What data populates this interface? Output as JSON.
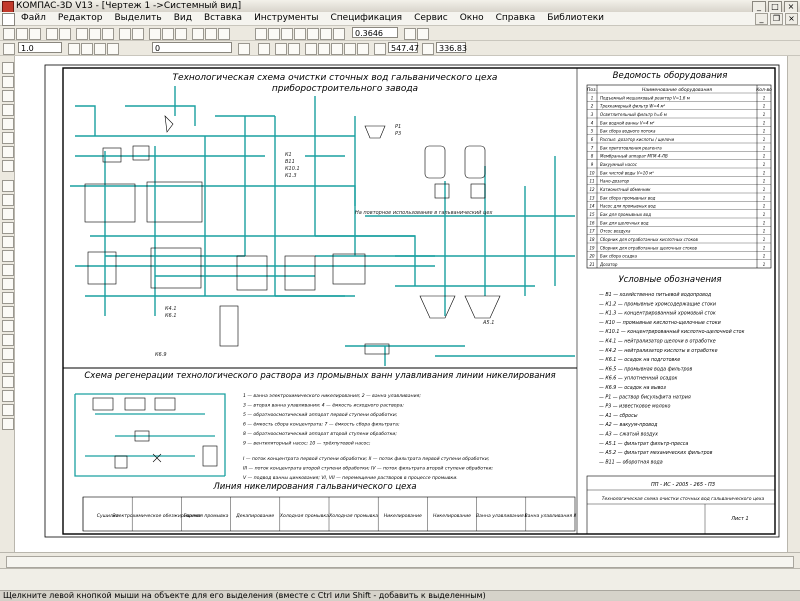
{
  "window": {
    "title": "КОМПАС-3D V13 - [Чертеж 1 ->Системный вид]"
  },
  "menu": [
    "Файл",
    "Редактор",
    "Выделить",
    "Вид",
    "Вставка",
    "Инструменты",
    "Спецификация",
    "Сервис",
    "Окно",
    "Справка",
    "Библиотеки"
  ],
  "toolbar": {
    "scale_value": "1.0",
    "layer_value": "0",
    "zoom_value": "0.3646",
    "coord_x": "547.47",
    "coord_y": "336.83"
  },
  "drawing": {
    "main_title": "Технологическая схема очистки сточных вод гальванического цеха",
    "main_subtitle": "приборостроительного завода",
    "equipment_title": "Ведомость оборудования",
    "equipment_header": [
      "Поз.",
      "Наименование оборудования",
      "Кол-во"
    ],
    "equipment_rows": [
      [
        "1",
        "Подъемный мешалковый реактор V=1,6 м",
        "1"
      ],
      [
        "2",
        "Трехкамерный фильтр W=4 м²",
        "1"
      ],
      [
        "3",
        "Осветлительный фильтр h=6 м",
        "1"
      ],
      [
        "4",
        "Бак водной ванны V=4 м³",
        "1"
      ],
      [
        "5",
        "Бак сбора водного потока",
        "1"
      ],
      [
        "6",
        "Распыл. дозатор кислоты / щелочи",
        "1"
      ],
      [
        "7",
        "Бак приготовления реагента",
        "1"
      ],
      [
        "8",
        "Мембранный аппарат МГМ-4-ЛВ",
        "1"
      ],
      [
        "9",
        "Вакуумный насос",
        "1"
      ],
      [
        "10",
        "Бак чистой воды V=10 м³",
        "1"
      ],
      [
        "11",
        "Нано-дозатор",
        "1"
      ],
      [
        "12",
        "Катионитный обменник",
        "1"
      ],
      [
        "13",
        "Бак сбора промывных вод",
        "1"
      ],
      [
        "14",
        "Насос для промывных вод",
        "1"
      ],
      [
        "15",
        "Бак для промывных вод",
        "1"
      ],
      [
        "16",
        "Бак для щелочных вод",
        "1"
      ],
      [
        "17",
        "Отсос воздуха",
        "1"
      ],
      [
        "18",
        "Сборник для отработанных кислотных стоков",
        "1"
      ],
      [
        "19",
        "Сборник для отработанных щелочных стоков",
        "1"
      ],
      [
        "20",
        "Бак сбора осадка",
        "1"
      ],
      [
        "21",
        "Дозатор",
        "1"
      ]
    ],
    "legend_title": "Условные обозначения",
    "legend_items": [
      "— В1 — хозяйственно питьевой водопровод",
      "— К1.2 — промывные хромсодержащие стоки",
      "— К1.3 — концентрированный хромовый сток",
      "— К10 — промывные кислотно-щелочные стоки",
      "— К10.1 — концентрированный кислотно-щелочной сток",
      "— К4.1 — нейтрализатор щелочи в отработке",
      "— К4.2 — нейтрализатор кислоты в отработке",
      "— К6.1 — осадок на подготовке",
      "— К6.5 — промывная вода фильтров",
      "— К6.6 — уплотненный осадок",
      "— К6.9 — осадок на вывоз",
      "— Р1 — раствор бисульфита натрия",
      "— Р3 — известковое молоко",
      "— А1 — сбросы",
      "— А2 — вакуум-провод",
      "— А3 — сжатый воздух",
      "— А5.1 — фильтрат фильтр-пресса",
      "— А5.2 — фильтрат механических фильтров",
      "— В11 — оборотная вода"
    ],
    "regen_title": "Схема регенерации технологического раствора из промывных ванн улавливания линии никелирования",
    "regen_notes": [
      "1 — ванна электрохимического никелирования; 2 — ванна улавливания;",
      "3 — вторая ванна улавливания; 4 — ёмкость исходного раствора;",
      "5 — обратноосмотический аппарат первой ступени обработки;",
      "6 — ёмкость сбора концентрата; 7 — ёмкость сбора фильтрата;",
      "8 — обратноосмотический аппарат второй ступени обработки;",
      "9 — вентиляторный насос; 10 — трёхпутевой насос;",
      "I — поток концентрата первой ступени обработки; II — поток фильтрата первой ступени обработки;",
      "III — поток концентрата второй ступени обработки; IV — поток фильтрата второй ступени обработки;",
      "V — подвод ванны цинкования; VI, VII — перемещение растворов в процессе промывки."
    ],
    "line_title": "Линия никелирования гальванического цеха",
    "line_cells": [
      "Сушилка",
      "Электрохимическое обезжиривание",
      "Горячая промывка",
      "Декапирование",
      "Холодная промывка",
      "Холодная промывка",
      "Никелирование",
      "Никелирование",
      "Ванна улавливания I",
      "Ванна улавливания II"
    ],
    "stamp": [
      "ПП - ИС - 2005 - 265 - ПЗ",
      "Технологическая схема очистки сточных вод гальванического цеха",
      "Лист 1"
    ],
    "inline_note": "На повторное использование в гальванический цех",
    "flow_labels": [
      "К1",
      "В11",
      "К10.1",
      "К1.3",
      "Р1",
      "Р3",
      "К4.1",
      "К6.1",
      "К6.9",
      "А5.1"
    ]
  },
  "status_text": "Щелкните левой кнопкой мыши на объекте для его выделения (вместе с Ctrl или Shift - добавить к выделенным)",
  "colors": {
    "frame": "#000000",
    "pipe": "#1aa0a0",
    "text": "#222222",
    "titlebar": "#e6e3da"
  }
}
